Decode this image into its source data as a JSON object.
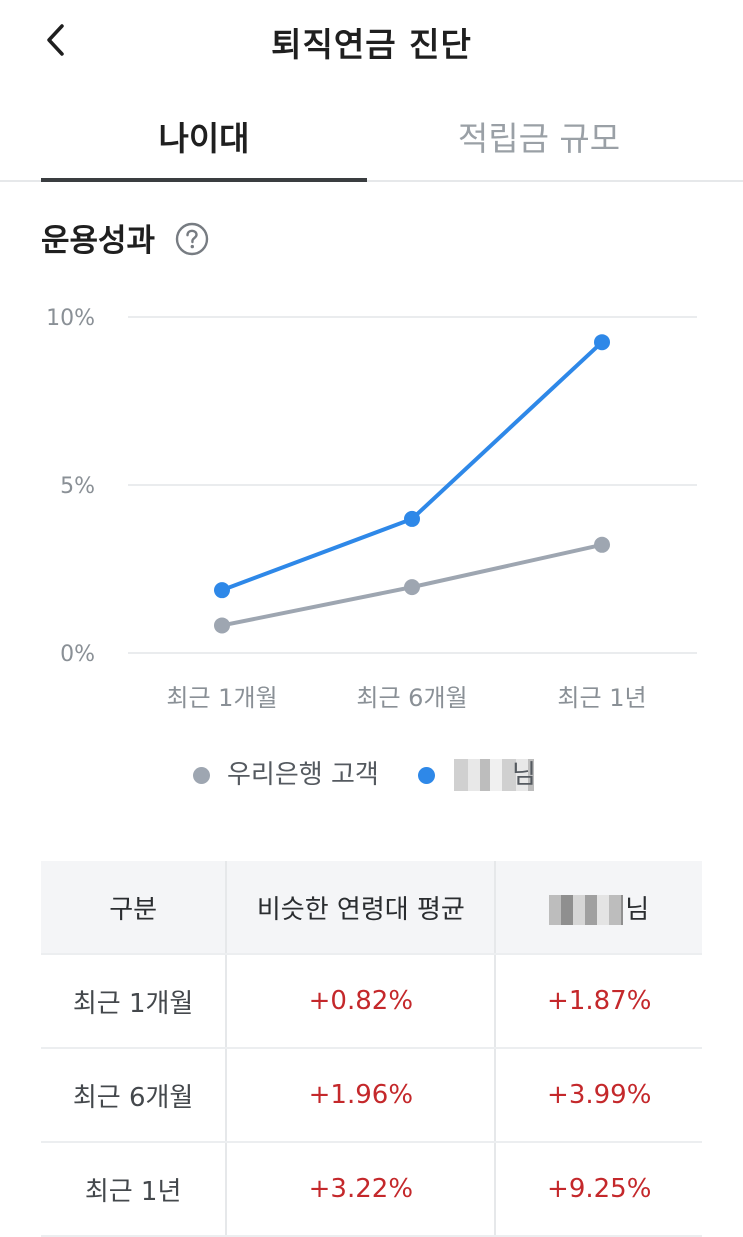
{
  "header": {
    "title": "퇴직연금 진단",
    "back_icon": "chevron-left-icon"
  },
  "tabs": [
    {
      "label": "나이대",
      "active": true
    },
    {
      "label": "적립금 규모",
      "active": false
    }
  ],
  "section": {
    "title": "운용성과",
    "help_icon": "question-circle-icon"
  },
  "colors": {
    "bank": "#9ea6b1",
    "user": "#2e88e8",
    "positive": "#c4282b"
  },
  "chart_data": {
    "type": "line",
    "categories": [
      "최근 1개월",
      "최근 6개월",
      "최근 1년"
    ],
    "y_ticks": [
      "0%",
      "5%",
      "10%"
    ],
    "ylim": [
      0,
      10
    ],
    "grid": true,
    "legend_position": "bottom",
    "series": [
      {
        "name": "우리은행 고객",
        "values": [
          0.82,
          1.96,
          3.22
        ]
      },
      {
        "name": "님",
        "values": [
          1.87,
          3.99,
          9.25
        ]
      }
    ]
  },
  "legend": {
    "bank_label": "우리은행 고객",
    "user_label": "님"
  },
  "table": {
    "headers": [
      "구분",
      "비슷한 연령대 평균",
      "님"
    ],
    "rows": [
      {
        "label": "최근 1개월",
        "avg": "+0.82%",
        "user": "+1.87%"
      },
      {
        "label": "최근 6개월",
        "avg": "+1.96%",
        "user": "+3.99%"
      },
      {
        "label": "최근 1년",
        "avg": "+3.22%",
        "user": "+9.25%"
      }
    ]
  }
}
